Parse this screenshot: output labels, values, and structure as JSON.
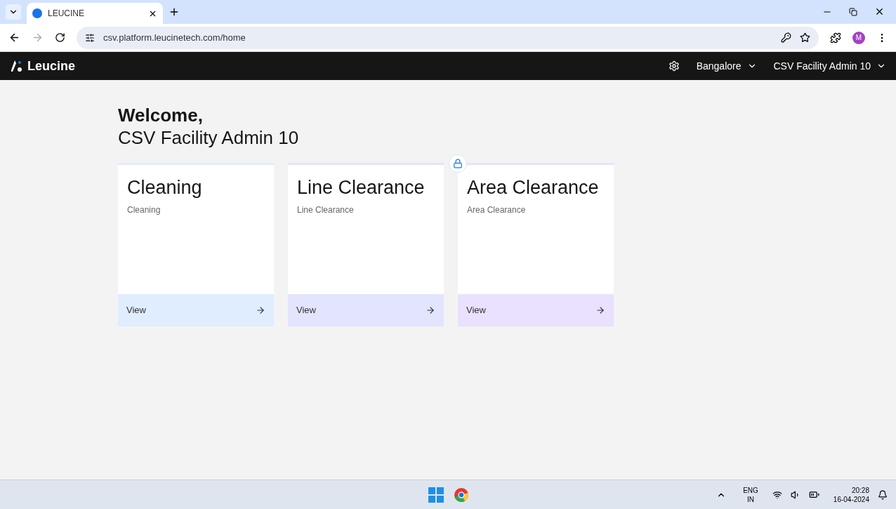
{
  "browser": {
    "tab_title": "LEUCINE",
    "url": "csv.platform.leucinetech.com/home",
    "profile_initial": "M"
  },
  "header": {
    "logo": "Leucine",
    "facility": "Bangalore",
    "user": "CSV Facility Admin 10"
  },
  "welcome": {
    "greeting": "Welcome,",
    "name": "CSV Facility Admin 10"
  },
  "cards": [
    {
      "title": "Cleaning",
      "subtitle": "Cleaning",
      "action": "View",
      "color": "#e0edff",
      "locked": false
    },
    {
      "title": "Line Clearance",
      "subtitle": "Line Clearance",
      "action": "View",
      "color": "#e2e5fd",
      "locked": false
    },
    {
      "title": "Area Clearance",
      "subtitle": "Area Clearance",
      "action": "View",
      "color": "#e9e1fd",
      "locked": true
    }
  ],
  "taskbar": {
    "language": "ENG",
    "region": "IN",
    "time": "20:28",
    "date": "16-04-2024"
  }
}
